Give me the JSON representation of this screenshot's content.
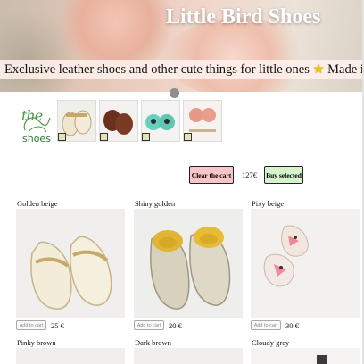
{
  "hero": {
    "title": "Little Bird Shoes",
    "tagline_text": "Exclusive leather shoes and other cute things for little ones",
    "tagline_icon": "star-icon",
    "tagline_suffix": "Made in Ireland"
  },
  "brand": {
    "logo_top": "the",
    "logo_bottom": "shoes"
  },
  "thumbnails": [
    {
      "badge_icon": "checkbox-icon"
    },
    {
      "badge_icon": "checkbox-icon"
    },
    {
      "badge_icon": "checkbox-icon"
    },
    {
      "badge_icon": "checkbox-icon"
    }
  ],
  "cart": {
    "clear_label": "Clear the cart",
    "total": "127€",
    "buy_label": "Buy selected"
  },
  "products": [
    {
      "name": "Golden beige",
      "add_label": "Add to cart",
      "price": "25 €"
    },
    {
      "name": "Shiny golden",
      "add_label": "Add to cart",
      "price": "20 €"
    },
    {
      "name": "Pixy beige",
      "add_label": "Add to cart",
      "price": "30 €"
    },
    {
      "name": "Pinky brown"
    },
    {
      "name": "Dark brown"
    },
    {
      "name": "Cloudy grey"
    }
  ],
  "colors": {
    "clear_button": "#f7c6c6",
    "buy_button": "#d5f4cc",
    "logo_green": "#4b9a46"
  }
}
